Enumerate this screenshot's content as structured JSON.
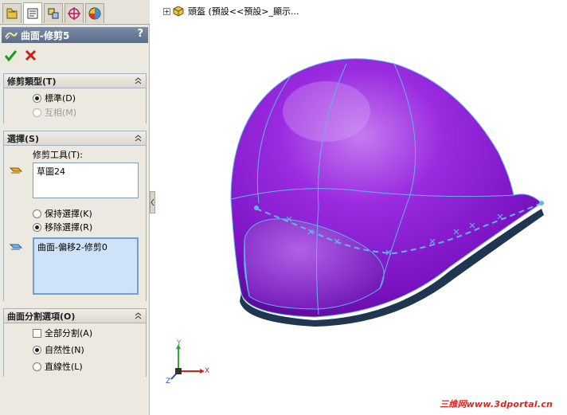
{
  "panel": {
    "title": "曲面-修剪5",
    "help": "?",
    "tabs": [
      {
        "name": "feature-manager-icon"
      },
      {
        "name": "property-manager-icon"
      },
      {
        "name": "configuration-manager-icon"
      },
      {
        "name": "dimxpert-icon"
      },
      {
        "name": "display-manager-icon"
      }
    ]
  },
  "trim_type": {
    "header": "修剪類型(T)",
    "options": [
      {
        "label": "標準(D)",
        "selected": true,
        "enabled": true
      },
      {
        "label": "互相(M)",
        "selected": false,
        "enabled": false
      }
    ]
  },
  "selection": {
    "header": "選擇(S)",
    "tool_label": "修剪工具(T):",
    "tool_value": "草圖24",
    "keep_option": "保持選擇(K)",
    "remove_option": "移除選擇(R)",
    "remove_selected": true,
    "surface_value": "曲面-偏移2-修剪0"
  },
  "split_options": {
    "header": "曲面分割選項(O)",
    "split_all": "全部分割(A)",
    "natural": "自然性(N)",
    "linear": "直線性(L)",
    "natural_selected": true
  },
  "tree": {
    "expander": "+",
    "text": "頭盔 (預設<<預設>_顯示..."
  },
  "triad": {
    "x": "X",
    "y": "Y",
    "z": "Z"
  },
  "watermark": "三维网www.3dportal.cn",
  "colors": {
    "surface": "#8f1fd6",
    "edge": "#5fb6e8",
    "panel_bg": "#ece9e0",
    "title_bg": "#5a6d8a"
  }
}
